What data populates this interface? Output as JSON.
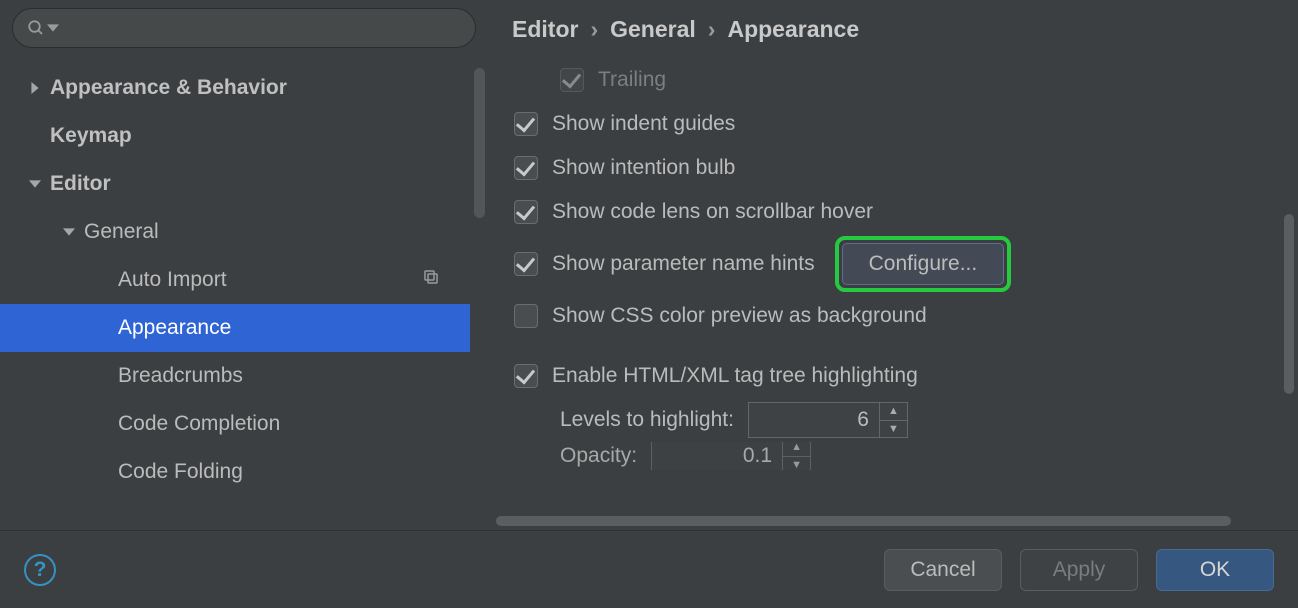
{
  "search": {
    "placeholder": ""
  },
  "sidebar": {
    "items": [
      {
        "label": "Appearance & Behavior",
        "level": 1,
        "bold": true,
        "arrow": "right",
        "selected": false
      },
      {
        "label": "Keymap",
        "level": 1,
        "bold": true,
        "arrow": "none",
        "selected": false
      },
      {
        "label": "Editor",
        "level": 1,
        "bold": true,
        "arrow": "down",
        "selected": false
      },
      {
        "label": "General",
        "level": 2,
        "bold": false,
        "arrow": "down",
        "selected": false
      },
      {
        "label": "Auto Import",
        "level": 3,
        "bold": false,
        "arrow": "none",
        "selected": false,
        "rightIcon": "copy-icon"
      },
      {
        "label": "Appearance",
        "level": 3,
        "bold": false,
        "arrow": "none",
        "selected": true
      },
      {
        "label": "Breadcrumbs",
        "level": 3,
        "bold": false,
        "arrow": "none",
        "selected": false
      },
      {
        "label": "Code Completion",
        "level": 3,
        "bold": false,
        "arrow": "none",
        "selected": false
      },
      {
        "label": "Code Folding",
        "level": 3,
        "bold": false,
        "arrow": "none",
        "selected": false
      }
    ]
  },
  "breadcrumb": {
    "parts": [
      "Editor",
      "General",
      "Appearance"
    ]
  },
  "options": {
    "trailing": {
      "label": "Trailing",
      "checked": true,
      "disabled": true
    },
    "indent_guides": {
      "label": "Show indent guides",
      "checked": true
    },
    "intention_bulb": {
      "label": "Show intention bulb",
      "checked": true
    },
    "code_lens": {
      "label": "Show code lens on scrollbar hover",
      "checked": true
    },
    "param_hints": {
      "label": "Show parameter name hints",
      "checked": true,
      "configure": "Configure..."
    },
    "css_color_bg": {
      "label": "Show CSS color preview as background",
      "checked": false
    },
    "tag_tree": {
      "label": "Enable HTML/XML tag tree highlighting",
      "checked": true
    },
    "levels": {
      "label": "Levels to highlight:",
      "value": "6"
    },
    "opacity": {
      "label": "Opacity:",
      "value": "0.1"
    }
  },
  "buttons": {
    "cancel": "Cancel",
    "apply": "Apply",
    "ok": "OK"
  }
}
